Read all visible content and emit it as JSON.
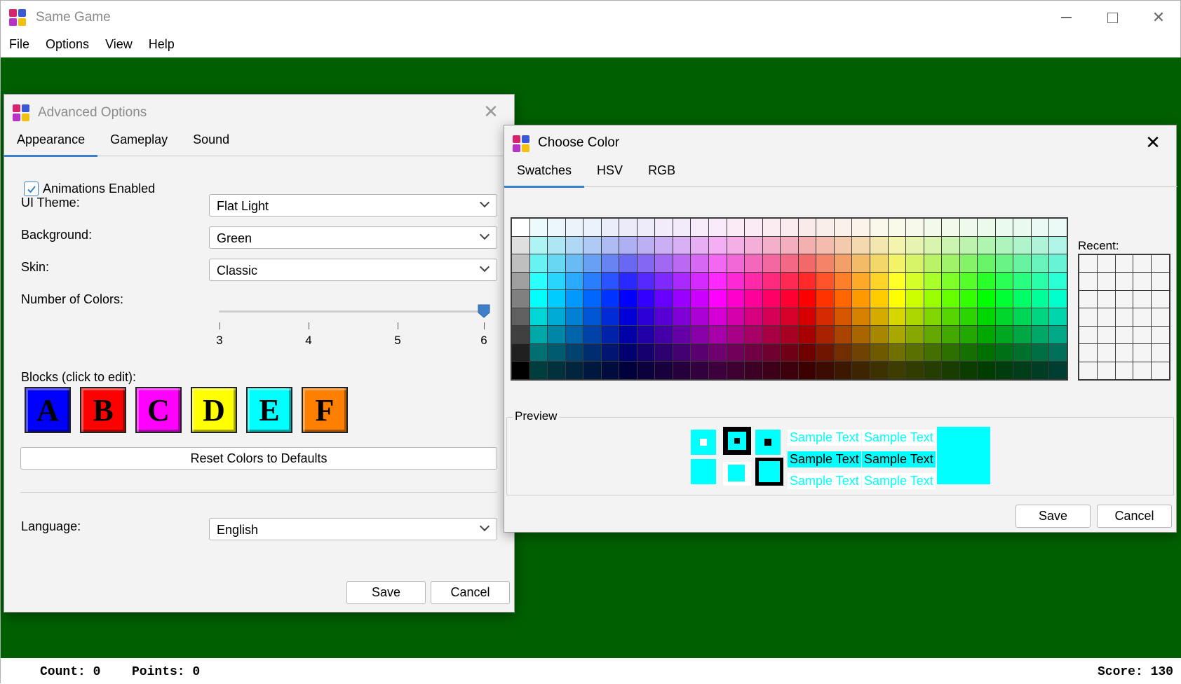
{
  "window": {
    "title": "Same Game",
    "menu": [
      "File",
      "Options",
      "View",
      "Help"
    ],
    "controls": {
      "minimize": "—",
      "close": "✕"
    }
  },
  "status": {
    "count": "Count: 0",
    "points": "Points: 0",
    "score": "Score: 130"
  },
  "colors": {
    "game_background": "#005f00",
    "accent": "#3f7ec8"
  },
  "advanced_options": {
    "title": "Advanced Options",
    "tabs": [
      "Appearance",
      "Gameplay",
      "Sound"
    ],
    "active_tab": "Appearance",
    "animations_label": "Animations Enabled",
    "animations_checked": true,
    "ui_theme": {
      "label": "UI Theme:",
      "value": "Flat Light"
    },
    "background": {
      "label": "Background:",
      "value": "Green"
    },
    "skin": {
      "label": "Skin:",
      "value": "Classic"
    },
    "num_colors": {
      "label": "Number of Colors:",
      "value": 6,
      "min": 3,
      "max": 6,
      "ticks": [
        "3",
        "4",
        "5",
        "6"
      ]
    },
    "blocks_label": "Blocks (click to edit):",
    "blocks": [
      {
        "letter": "A",
        "color": "#0000ff"
      },
      {
        "letter": "B",
        "color": "#ff0000"
      },
      {
        "letter": "C",
        "color": "#ff00ff"
      },
      {
        "letter": "D",
        "color": "#ffff00"
      },
      {
        "letter": "E",
        "color": "#00ffff"
      },
      {
        "letter": "F",
        "color": "#ff8000"
      }
    ],
    "reset_label": "Reset Colors to Defaults",
    "language": {
      "label": "Language:",
      "value": "English"
    },
    "save_label": "Save",
    "cancel_label": "Cancel"
  },
  "choose_color": {
    "title": "Choose Color",
    "tabs": [
      "Swatches",
      "HSV",
      "RGB"
    ],
    "active_tab": "Swatches",
    "recent_label": "Recent:",
    "preview_label": "Preview",
    "sample_text": "Sample Text",
    "selected_color": "#00ffff",
    "save_label": "Save",
    "cancel_label": "Cancel"
  }
}
